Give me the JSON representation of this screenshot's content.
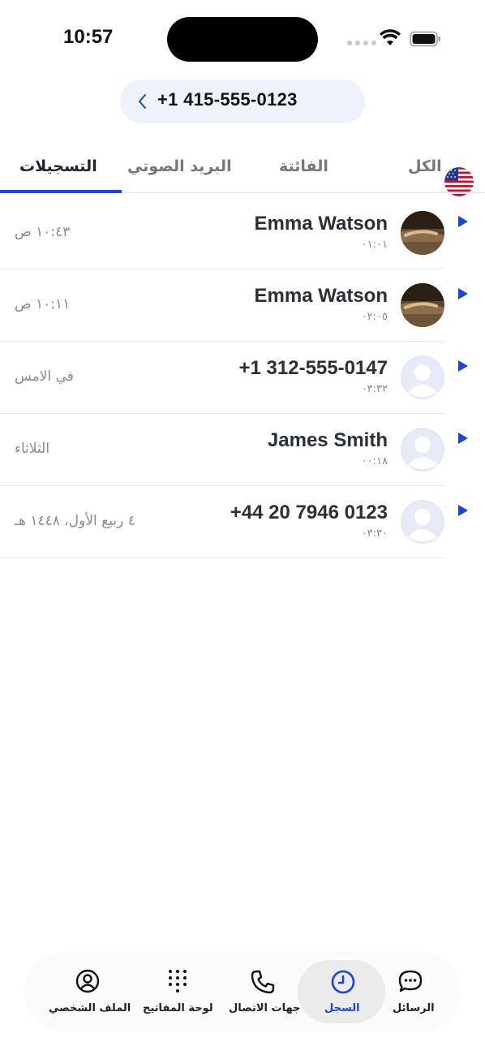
{
  "status_bar": {
    "time": "10:57"
  },
  "number_pill": {
    "number": "+1 415-555-0123",
    "flag": "us-flag-icon"
  },
  "tabs": [
    {
      "label": "التسجيلات",
      "active": true
    },
    {
      "label": "البريد الصوتي",
      "active": false
    },
    {
      "label": "الفائتة",
      "active": false
    },
    {
      "label": "الكل",
      "active": false
    }
  ],
  "calls": [
    {
      "name": "Emma Watson",
      "duration": "٠١:٠١",
      "when": "١٠:٤٣ ص",
      "avatar": "photo"
    },
    {
      "name": "Emma Watson",
      "duration": "٠٢:٠٥",
      "when": "١٠:١١ ص",
      "avatar": "photo"
    },
    {
      "name": "+1 312-555-0147",
      "duration": "٠٣:٣٢",
      "when": "في الامس",
      "avatar": "placeholder"
    },
    {
      "name": "James Smith",
      "duration": "٠٠:١٨",
      "when": "الثلاثاء",
      "avatar": "placeholder"
    },
    {
      "name": "+44 20 7946 0123",
      "duration": "٠٣:٣٠",
      "when": "٤ ربيع الأول، ١٤٤٨ هـ",
      "avatar": "placeholder"
    }
  ],
  "bottom_nav": {
    "profile": "الملف الشخصي",
    "keypad": "لوحة المفاتيح",
    "contacts": "جهات الاتصال",
    "history": "السجل",
    "messages": "الرسائل"
  },
  "colors": {
    "accent": "#1a44e8",
    "pill_bg": "#eef2fa"
  }
}
